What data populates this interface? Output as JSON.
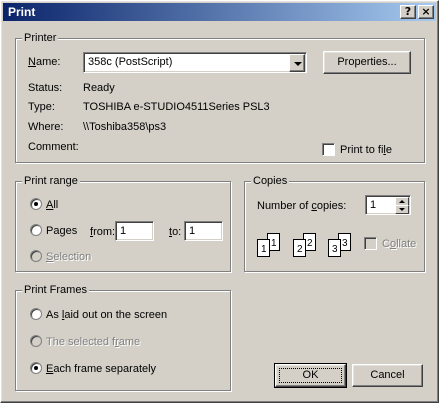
{
  "window": {
    "title": "Print",
    "help_glyph": "?",
    "close_glyph": "×"
  },
  "printer": {
    "group_label": "Printer",
    "name_label": "Name:",
    "name_value": "358c (PostScript)",
    "properties_label": "Properties...",
    "status_label": "Status:",
    "status_value": "Ready",
    "type_label": "Type:",
    "type_value": "TOSHIBA e-STUDIO4511Series PSL3",
    "where_label": "Where:",
    "where_value": "\\\\Toshiba358\\ps3",
    "comment_label": "Comment:",
    "print_to_file_label": "Print to file",
    "print_to_file_checked": false
  },
  "print_range": {
    "group_label": "Print range",
    "all_label": "All",
    "pages_label": "Pages",
    "from_label": "from:",
    "from_value": "1",
    "to_label": "to:",
    "to_value": "1",
    "selection_label": "Selection",
    "selected": "all"
  },
  "copies": {
    "group_label": "Copies",
    "number_label": "Number of copies:",
    "number_value": "1",
    "collate_label": "Collate",
    "page_icons": [
      "1",
      "1",
      "2",
      "2",
      "3",
      "3"
    ]
  },
  "print_frames": {
    "group_label": "Print Frames",
    "as_laid_out_label": "As laid out on the screen",
    "selected_frame_label": "The selected frame",
    "each_frame_label": "Each frame separately",
    "selected": "each_frame"
  },
  "buttons": {
    "ok_label": "OK",
    "cancel_label": "Cancel"
  },
  "colors": {
    "titlebar_start": "#0a246a",
    "titlebar_end": "#a6caf0",
    "face": "#d4d0c8"
  }
}
